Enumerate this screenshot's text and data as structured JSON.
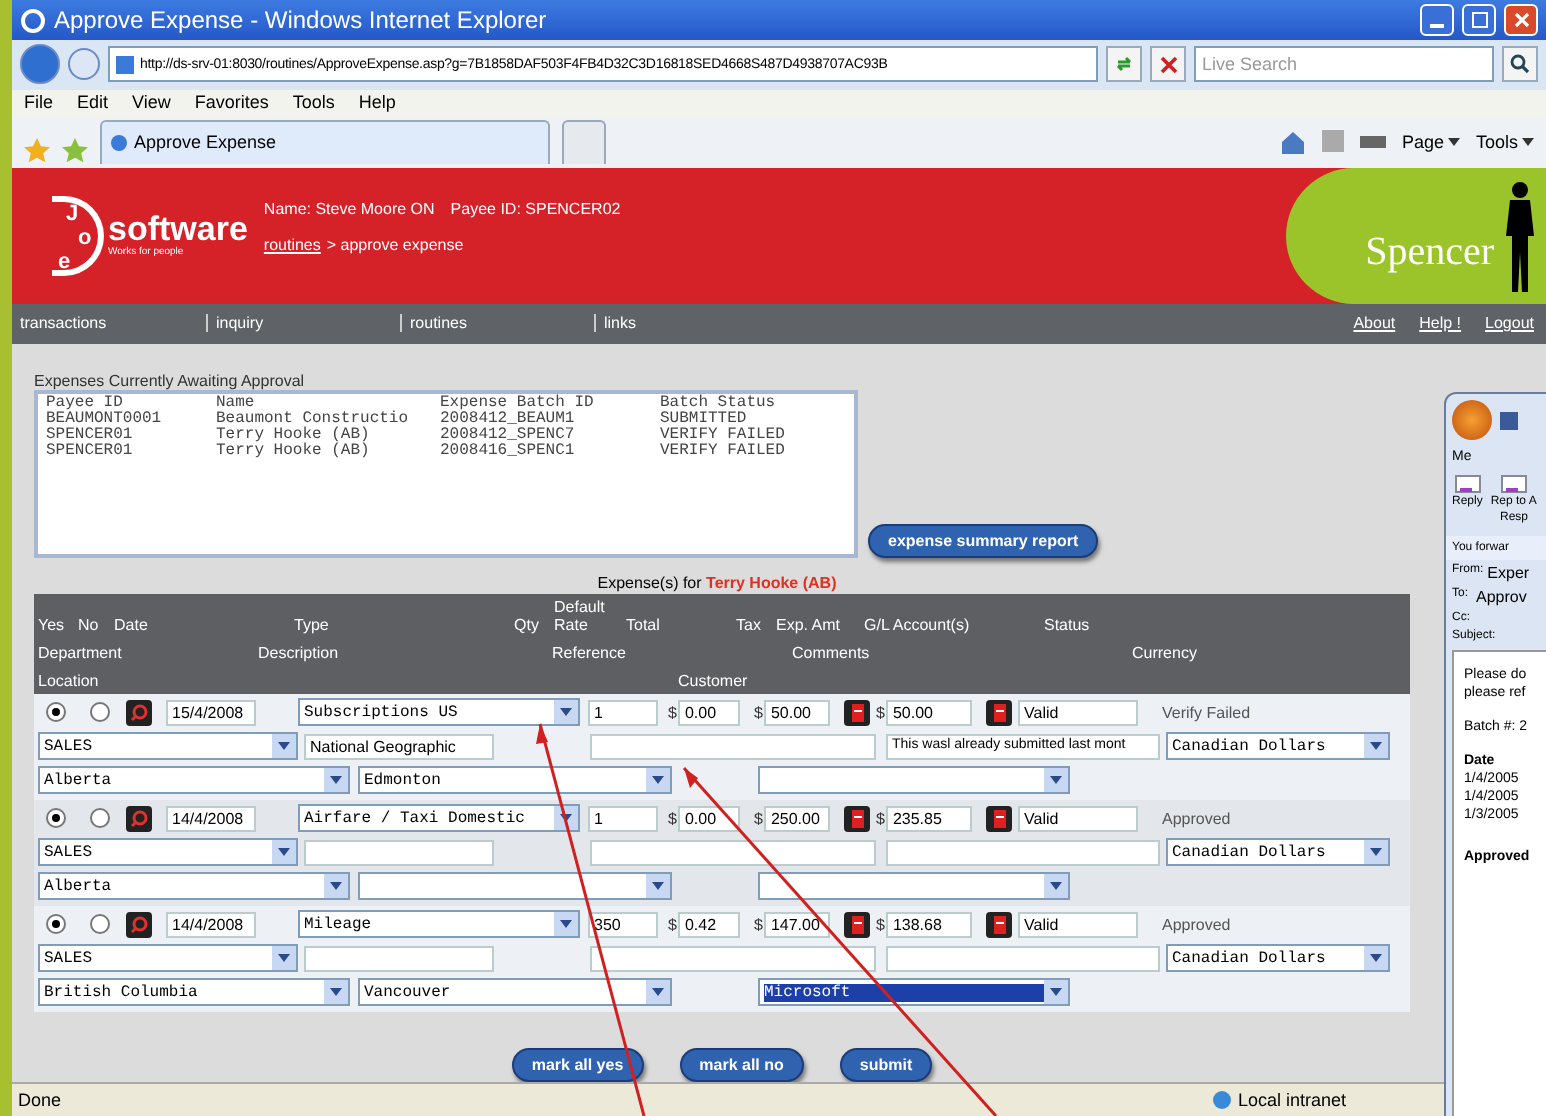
{
  "window": {
    "title": "Approve Expense - Windows Internet Explorer"
  },
  "address_bar": {
    "url": "http://ds-srv-01:8030/routines/ApproveExpense.asp?g=7B1858DAF503F4FB4D32C3D16818SED4668S487D4938707AC93B",
    "search_placeholder": "Live Search"
  },
  "menu": [
    "File",
    "Edit",
    "View",
    "Favorites",
    "Tools",
    "Help"
  ],
  "tabs": [
    {
      "label": "Approve Expense",
      "selected": true
    }
  ],
  "command_bar": [
    "Page",
    "Tools"
  ],
  "header": {
    "logo_letters": [
      "J",
      "o",
      "e"
    ],
    "logo": "software",
    "tagline": "Works for people",
    "user": "Name: Steve Moore ON",
    "payee": "Payee ID: SPENCER02",
    "breadcrumb_link": "routines",
    "breadcrumb_rest": "> approve expense",
    "brand": "Spencer"
  },
  "nav": {
    "left": [
      "transactions",
      "inquiry",
      "routines",
      "links"
    ],
    "right": [
      "About",
      "Help !",
      "Logout"
    ]
  },
  "awaiting": {
    "title": "Expenses Currently Awaiting Approval",
    "columns": [
      "Payee ID",
      "Name",
      "Expense Batch ID",
      "Batch Status"
    ],
    "rows": [
      [
        "BEAUMONT0001",
        "Beaumont Constructio",
        "2008412_BEAUM1",
        "SUBMITTED"
      ],
      [
        "SPENCER01",
        "Terry Hooke (AB)",
        "2008412_SPENC7",
        "VERIFY FAILED"
      ],
      [
        "SPENCER01",
        "Terry Hooke (AB)",
        "2008416_SPENC1",
        "VERIFY FAILED"
      ]
    ]
  },
  "summary_button": "expense summary report",
  "expenses": {
    "title_prefix": "Expense(s) for",
    "payee": "Terry Hooke (AB)",
    "header_lines": [
      [
        "Yes",
        "No",
        "Date",
        "Type",
        "Qty",
        "Default Rate",
        "Total",
        "Tax",
        "Exp. Amt",
        "G/L Account(s)",
        "Status"
      ],
      [
        "Department",
        "Description",
        "Reference",
        "Comments",
        "Currency"
      ],
      [
        "Location",
        "Customer"
      ]
    ],
    "rows": [
      {
        "yes": true,
        "no": false,
        "date": "15/4/2008",
        "type": "Subscriptions US",
        "qty": "1",
        "rate": {
          "symbol": "$",
          "value": "0.00"
        },
        "total": {
          "symbol": "$",
          "value": "50.00"
        },
        "exp_amt": {
          "symbol": "$",
          "value": "50.00"
        },
        "gl": "Valid",
        "status": "Verify Failed",
        "department": "SALES",
        "description": "National Geographic",
        "comments": "This wasl already submitted last mont",
        "currency": "Canadian Dollars",
        "location": "Alberta",
        "city": "Edmonton",
        "customer_focused": false
      },
      {
        "yes": true,
        "no": false,
        "date": "14/4/2008",
        "type": "Airfare / Taxi Domestic",
        "qty": "1",
        "rate": {
          "symbol": "$",
          "value": "0.00"
        },
        "total": {
          "symbol": "$",
          "value": "250.00"
        },
        "exp_amt": {
          "symbol": "$",
          "value": "235.85"
        },
        "gl": "Valid",
        "status": "Approved",
        "department": "SALES",
        "currency": "Canadian Dollars",
        "location": "Alberta",
        "customer_focused": false
      },
      {
        "yes": true,
        "no": false,
        "date": "14/4/2008",
        "type": "Mileage",
        "qty": "350",
        "rate": {
          "symbol": "$",
          "value": "0.42"
        },
        "total": {
          "symbol": "$",
          "value": "147.00"
        },
        "exp_amt": {
          "symbol": "$",
          "value": "138.68"
        },
        "gl": "Valid",
        "status": "Approved",
        "department": "SALES",
        "currency": "Canadian Dollars",
        "location": "British Columbia",
        "city": "Vancouver",
        "customer": "Microsoft",
        "customer_focused": true
      }
    ]
  },
  "buttons": [
    "mark all yes",
    "mark all no",
    "submit"
  ],
  "status_bar": {
    "text": "Done",
    "zone": "Local intranet"
  },
  "email_window": {
    "ribbon_tab": "Me",
    "actions": [
      "Reply",
      "Rep to A"
    ],
    "group": "Resp",
    "info": "You forwar",
    "from_label": "From:",
    "from": "Exper",
    "to_label": "To:",
    "to": "Approv",
    "cc_label": "Cc:",
    "subject_label": "Subject:",
    "body": [
      "Please do",
      "please ref"
    ],
    "batch": "Batch #: 2",
    "date_header": "Date",
    "dates": [
      "1/4/2005",
      "1/4/2005",
      "1/3/2005"
    ],
    "footer": "Approved"
  }
}
